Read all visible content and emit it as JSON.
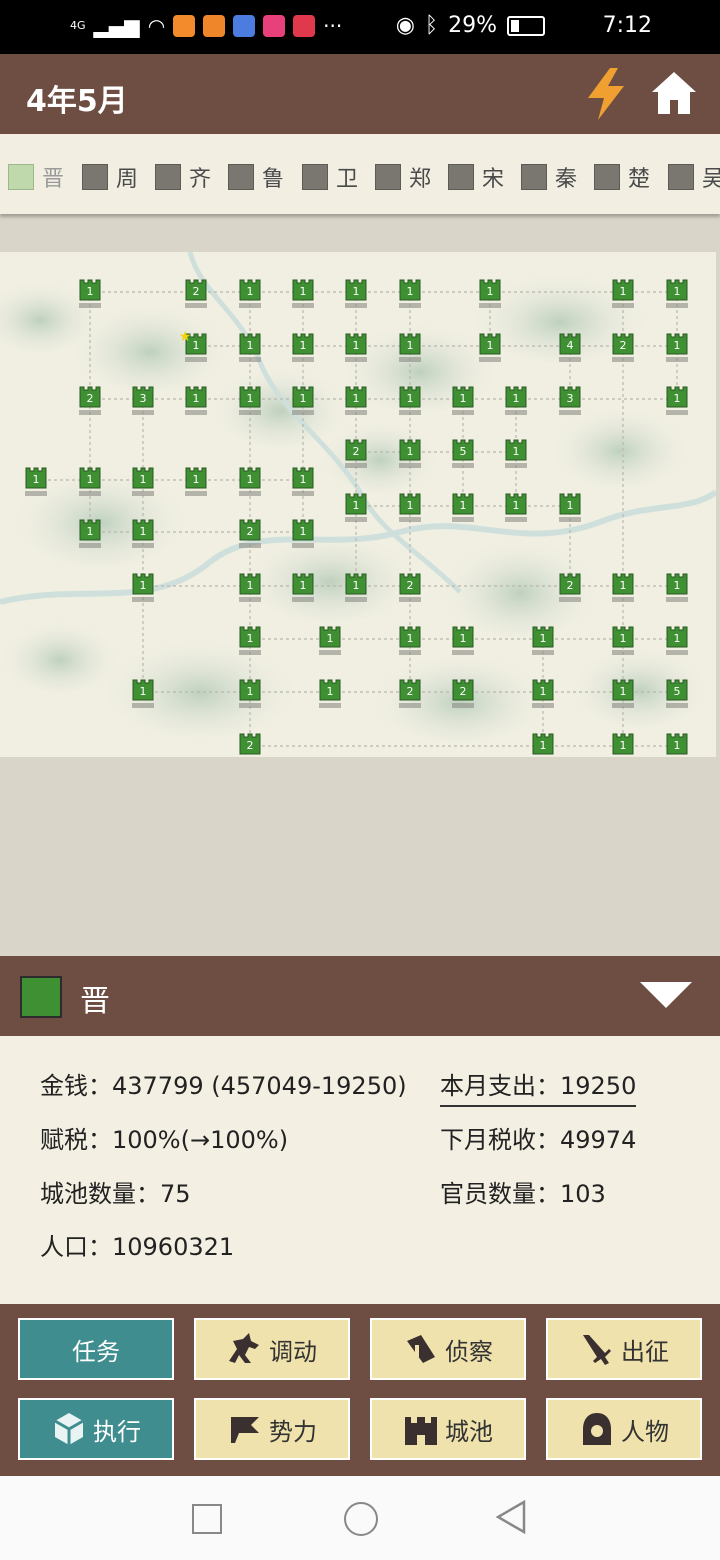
{
  "status_bar": {
    "network": "4G",
    "battery": "29%",
    "time": "7:12",
    "more": "···"
  },
  "header": {
    "date": "4年5月",
    "icons": [
      "bolt-icon",
      "home-icon"
    ]
  },
  "factions": [
    "晋",
    "周",
    "齐",
    "鲁",
    "卫",
    "郑",
    "宋",
    "秦",
    "楚",
    "吴"
  ],
  "map": {
    "city_counts": [
      "1",
      "2",
      "1",
      "1",
      "1",
      "1",
      "1",
      "1",
      "1",
      "1",
      "1",
      "1",
      "1",
      "1",
      "1",
      "4",
      "2",
      "1",
      "2",
      "3",
      "1",
      "1",
      "1",
      "1",
      "1",
      "1",
      "1",
      "3",
      "1",
      "2",
      "1",
      "5",
      "1",
      "1",
      "1",
      "1",
      "1",
      "1",
      "1",
      "1",
      "1",
      "1",
      "1",
      "1",
      "1",
      "1",
      "2",
      "1",
      "1",
      "1",
      "1",
      "1",
      "2",
      "2",
      "1",
      "1",
      "1",
      "1",
      "1",
      "1",
      "1",
      "1",
      "1",
      "1",
      "1",
      "1",
      "2",
      "2",
      "1",
      "1",
      "5",
      "2",
      "1",
      "1",
      "1"
    ]
  },
  "selected_faction": {
    "name": "晋",
    "color": "#3f8f33"
  },
  "stats": {
    "money": "金钱：437799 (457049-19250)",
    "monthly_expense": "本月支出：19250",
    "tax_rate": "赋税：100%(→100%)",
    "next_tax": "下月税收：49974",
    "city_count": "城池数量：75",
    "officer_count": "官员数量：103",
    "population": "人口：10960321"
  },
  "actions": [
    {
      "label": "任务",
      "icon": ""
    },
    {
      "label": "调动",
      "icon": "horse-icon"
    },
    {
      "label": "侦察",
      "icon": "telescope-icon"
    },
    {
      "label": "出征",
      "icon": "sword-icon"
    },
    {
      "label": "执行",
      "icon": "cube-icon"
    },
    {
      "label": "势力",
      "icon": "flag-icon"
    },
    {
      "label": "城池",
      "icon": "castle-icon"
    },
    {
      "label": "人物",
      "icon": "person-icon"
    }
  ],
  "colors": {
    "brown": "#6e4d42",
    "teal": "#3f8d8f",
    "button_cream": "#efe2ac",
    "city_green": "#3f8f33"
  }
}
